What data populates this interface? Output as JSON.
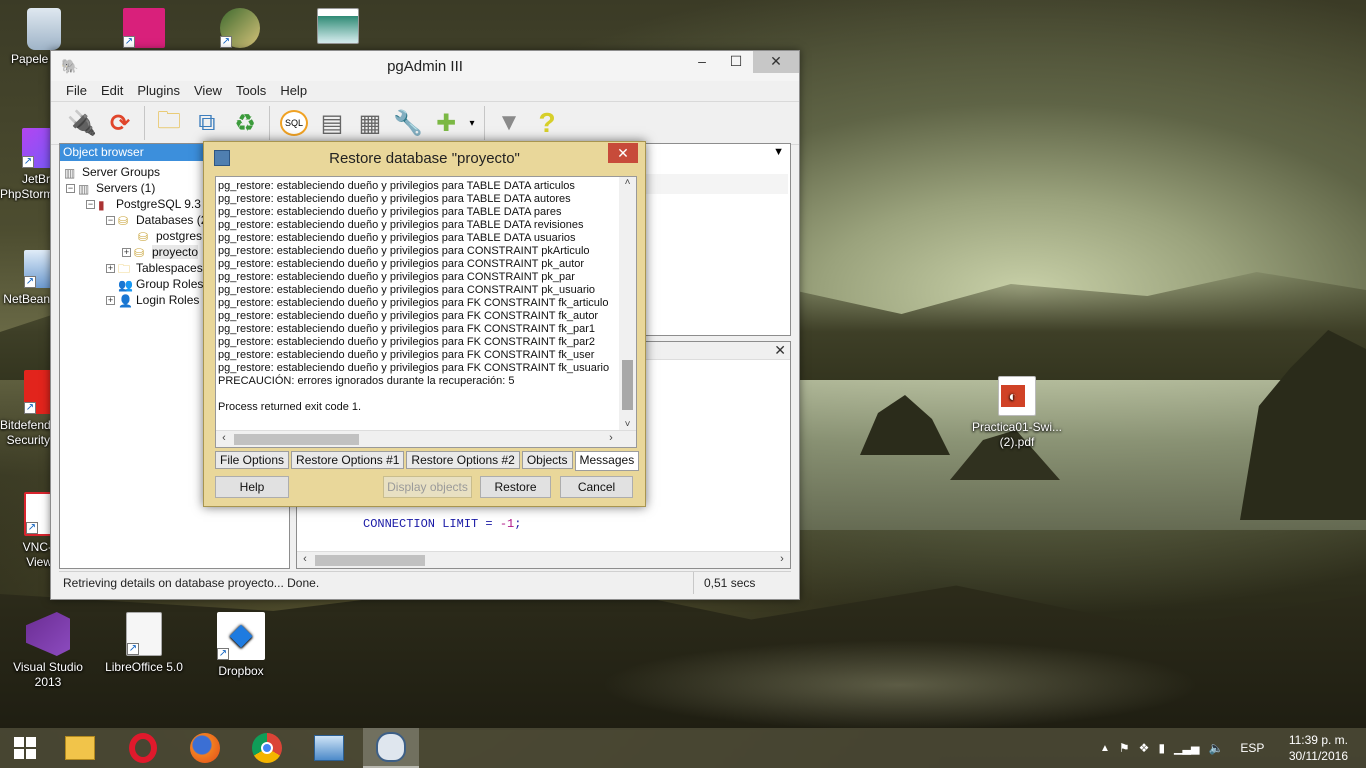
{
  "desktop": {
    "icons": [
      {
        "label": "Papele recic"
      },
      {
        "label": ""
      },
      {
        "label": ""
      },
      {
        "label": ""
      },
      {
        "label": "JetBr PhpStorm"
      },
      {
        "label": "NetBean"
      },
      {
        "label": "Bitdefend Security"
      },
      {
        "label": "VNC-View"
      },
      {
        "label": "Visual Studio 2013"
      },
      {
        "label": "LibreOffice 5.0"
      },
      {
        "label": "Dropbox"
      },
      {
        "label": "Practica01-Swi...(2).pdf"
      }
    ]
  },
  "pgadmin": {
    "title": "pgAdmin III",
    "menu": [
      "File",
      "Edit",
      "Plugins",
      "View",
      "Tools",
      "Help"
    ],
    "toolbar": {
      "sql_label": "SQL"
    },
    "object_browser": {
      "header": "Object browser",
      "tree": [
        {
          "label": "Server Groups"
        },
        {
          "label": "Servers (1)"
        },
        {
          "label": "PostgreSQL 9.3 ("
        },
        {
          "label": "Databases (2"
        },
        {
          "label": "postgres"
        },
        {
          "label": "proyecto"
        },
        {
          "label": "Tablespaces"
        },
        {
          "label": "Group Roles"
        },
        {
          "label": "Login Roles ("
        }
      ]
    },
    "sql_pane": {
      "line_prefix": "CONNECTION LIMIT = ",
      "line_value": "-1",
      "line_suffix": ";"
    },
    "status": {
      "text": "Retrieving details on database proyecto... Done.",
      "time": "0,51 secs"
    }
  },
  "restore_dialog": {
    "title": "Restore database \"proyecto\"",
    "messages": [
      "pg_restore: estableciendo dueño y privilegios para TABLE DATA articulos",
      "pg_restore: estableciendo dueño y privilegios para TABLE DATA autores",
      "pg_restore: estableciendo dueño y privilegios para TABLE DATA pares",
      "pg_restore: estableciendo dueño y privilegios para TABLE DATA revisiones",
      "pg_restore: estableciendo dueño y privilegios para TABLE DATA usuarios",
      "pg_restore: estableciendo dueño y privilegios para CONSTRAINT pkArticulo",
      "pg_restore: estableciendo dueño y privilegios para CONSTRAINT pk_autor",
      "pg_restore: estableciendo dueño y privilegios para CONSTRAINT pk_par",
      "pg_restore: estableciendo dueño y privilegios para CONSTRAINT pk_usuario",
      "pg_restore: estableciendo dueño y privilegios para FK CONSTRAINT fk_articulo",
      "pg_restore: estableciendo dueño y privilegios para FK CONSTRAINT fk_autor",
      "pg_restore: estableciendo dueño y privilegios para FK CONSTRAINT fk_par1",
      "pg_restore: estableciendo dueño y privilegios para FK CONSTRAINT fk_par2",
      "pg_restore: estableciendo dueño y privilegios para FK CONSTRAINT fk_user",
      "pg_restore: estableciendo dueño y privilegios para FK CONSTRAINT fk_usuario",
      "PRECAUCIÓN: errores ignorados durante la recuperación: 5",
      "",
      "Process returned exit code 1."
    ],
    "tabs": [
      "File Options",
      "Restore Options #1",
      "Restore Options #2",
      "Objects",
      "Messages"
    ],
    "active_tab": "Messages",
    "buttons": {
      "help": "Help",
      "display_objects": "Display objects",
      "restore": "Restore",
      "cancel": "Cancel"
    }
  },
  "taskbar": {
    "language": "ESP",
    "time": "11:39 p. m.",
    "date": "30/11/2016"
  }
}
